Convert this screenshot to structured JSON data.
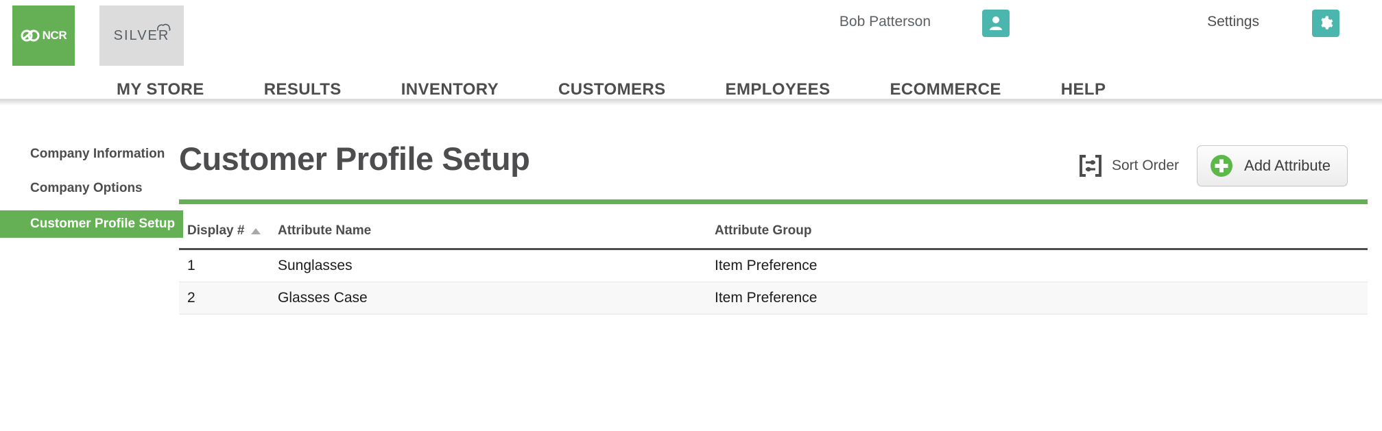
{
  "header": {
    "logo": {
      "ncr_text": "NCR",
      "silver_text": "SILVER"
    },
    "user_name": "Bob Patterson",
    "settings_label": "Settings",
    "user_icon": "user-avatar-icon",
    "gear_icon": "gear-icon",
    "accent_teal": "#4bb6ae",
    "brand_green": "#65b054"
  },
  "nav": {
    "items": [
      {
        "label": "MY STORE"
      },
      {
        "label": "RESULTS"
      },
      {
        "label": "INVENTORY"
      },
      {
        "label": "CUSTOMERS"
      },
      {
        "label": "EMPLOYEES"
      },
      {
        "label": "ECOMMERCE"
      },
      {
        "label": "HELP"
      }
    ]
  },
  "sidebar": {
    "items": [
      {
        "label": "Company Information",
        "active": false
      },
      {
        "label": "Company Options",
        "active": false
      },
      {
        "label": "Customer Profile Setup",
        "active": true
      }
    ]
  },
  "main": {
    "title": "Customer Profile Setup",
    "sort_order_label": "Sort Order",
    "sort_order_icon": "sort-order-icon",
    "add_attribute_label": "Add Attribute",
    "add_attribute_icon": "plus-circle-icon",
    "divider_color": "#65b054",
    "table": {
      "columns": [
        {
          "key": "display",
          "label": "Display #",
          "sorted": "asc"
        },
        {
          "key": "name",
          "label": "Attribute Name",
          "sorted": ""
        },
        {
          "key": "group",
          "label": "Attribute Group",
          "sorted": ""
        }
      ],
      "rows": [
        {
          "display": "1",
          "name": "Sunglasses",
          "group": "Item Preference"
        },
        {
          "display": "2",
          "name": "Glasses Case",
          "group": "Item Preference"
        }
      ]
    }
  }
}
